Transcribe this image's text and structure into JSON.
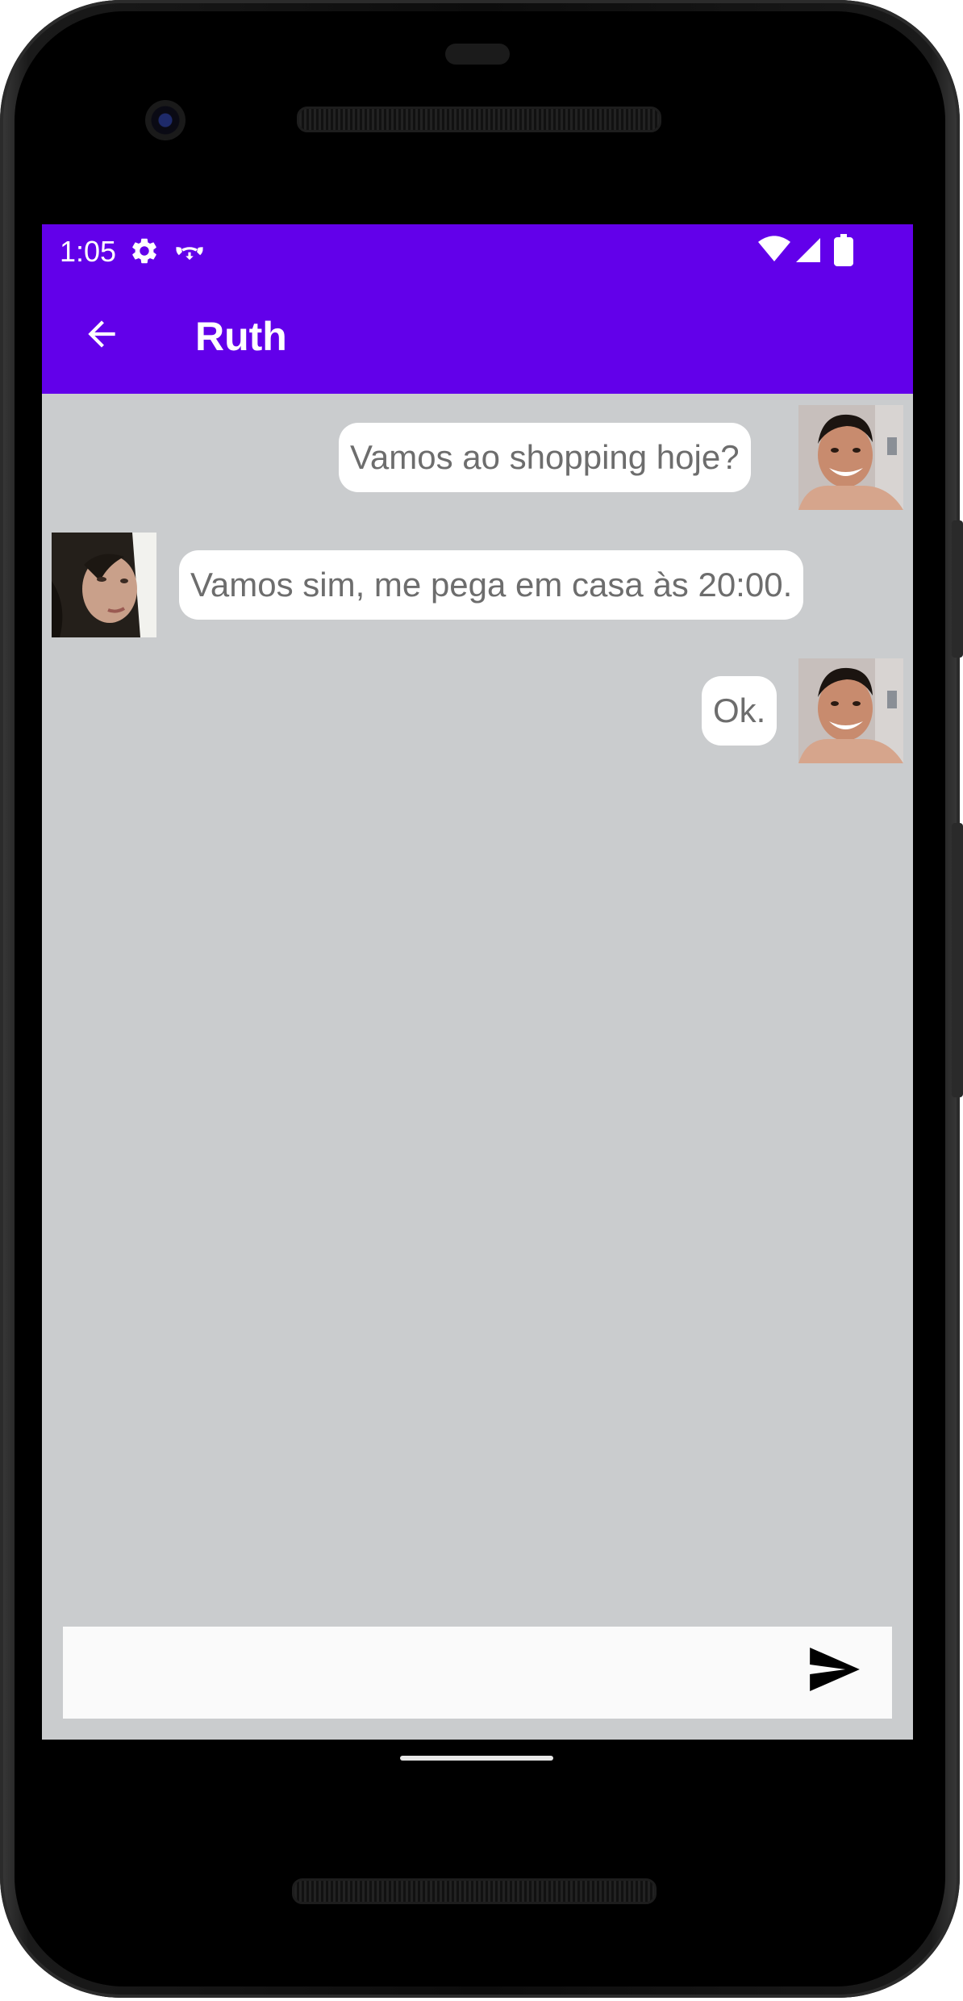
{
  "status_bar": {
    "time": "1:05",
    "left_icons": [
      "settings-icon",
      "call-end-icon"
    ],
    "right_icons": [
      "wifi-icon",
      "signal-icon",
      "battery-icon"
    ]
  },
  "app_bar": {
    "title": "Ruth",
    "back_icon": "arrow-back-icon"
  },
  "messages": [
    {
      "sender": "me",
      "text": "Vamos ao shopping hoje?"
    },
    {
      "sender": "Ruth",
      "text": "Vamos sim, me pega em casa às 20:00."
    },
    {
      "sender": "me",
      "text": "Ok."
    }
  ],
  "composer": {
    "value": "",
    "placeholder": "",
    "send_icon": "send-icon"
  },
  "colors": {
    "primary": "#6200ea",
    "chat_background": "#caccce",
    "bubble": "#ffffff",
    "bubble_text": "#6d6d6d",
    "composer_background": "#fafafa"
  }
}
